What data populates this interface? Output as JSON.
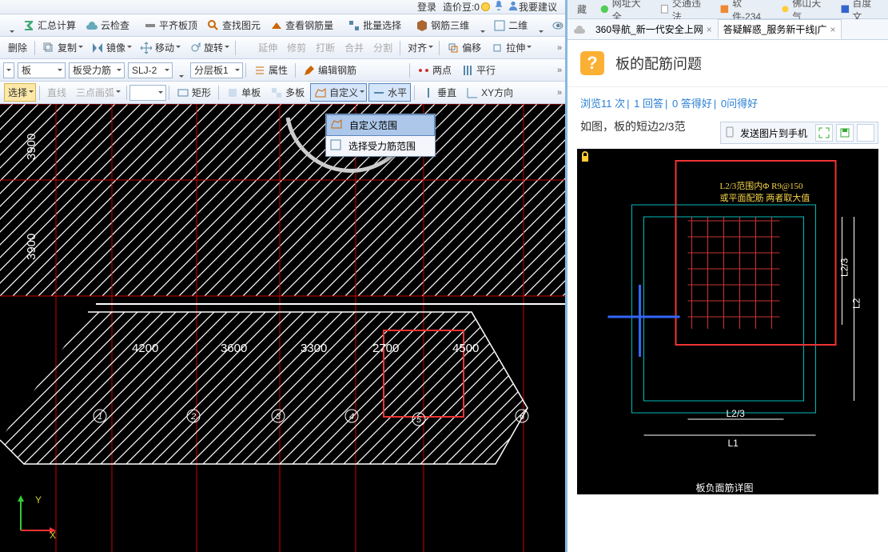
{
  "header": {
    "login": "登录",
    "price_coin": "造价豆:",
    "coin_value": 0,
    "suggest": "我要建议"
  },
  "row1": {
    "sum": "汇总计算",
    "cloud": "云检查",
    "level": "平齐板顶",
    "find": "查找图元",
    "steel": "查看钢筋量",
    "batch": "批量选择",
    "three": "钢筋三维",
    "two": "二维",
    "view": "俯视"
  },
  "row2": {
    "del": "删除",
    "copy": "复制",
    "mirror": "镜像",
    "move": "移动",
    "rotate": "旋转",
    "extend": "延伸",
    "fix": "修剪",
    "break": "打断",
    "merge": "合并",
    "split": "分割",
    "align": "对齐",
    "offset": "偏移",
    "drag": "拉伸"
  },
  "row3": {
    "type": "板",
    "force": "板受力筋",
    "slj": "SLJ-2",
    "layer": "分层板1",
    "attr": "属性",
    "edit": "编辑钢筋",
    "two": "两点",
    "parallel": "平行"
  },
  "row4": {
    "select": "选择",
    "sline": "直线",
    "arc": "三点画弧",
    "rect": "矩形",
    "single": "单板",
    "multi": "多板",
    "custom": "自定义",
    "horiz": "水平",
    "vert": "垂直",
    "xy": "XY方向"
  },
  "popup": {
    "item1": "自定义范围",
    "item2": "选择受力筋范围"
  },
  "dims": {
    "v1": "3900",
    "v2": "3900",
    "h1": "4200",
    "h2": "3600",
    "h3": "3300",
    "h4": "2700",
    "h5": "4500"
  },
  "axes": {
    "y": "Y",
    "x": "X"
  },
  "right": {
    "toptabs": {
      "hide": "藏",
      "nav": "网址大全",
      "traffic": "交通违法",
      "soft": "软件-234",
      "weather": "佛山天气",
      "baidu": "百度文"
    },
    "tabs": {
      "t1": "360导航_新一代安全上网",
      "t2": "答疑解惑_服务新干线|广"
    },
    "q_title": "板的配筋问题",
    "stats": {
      "views": "浏览11 次",
      "answers": "1 回答",
      "good": "0 答得好",
      "ask": "0问得好"
    },
    "desc": "如图，板的短边2/3范",
    "send": "发送图片到手机",
    "diag": {
      "t1": "L2/3范围内Φ R9@150",
      "t2": "或平面配筋 两者取大值",
      "l23v": "L2/3",
      "l2": "L2",
      "l23": "L2/3",
      "l1": "L1",
      "caption": "板负面筋详图"
    }
  }
}
